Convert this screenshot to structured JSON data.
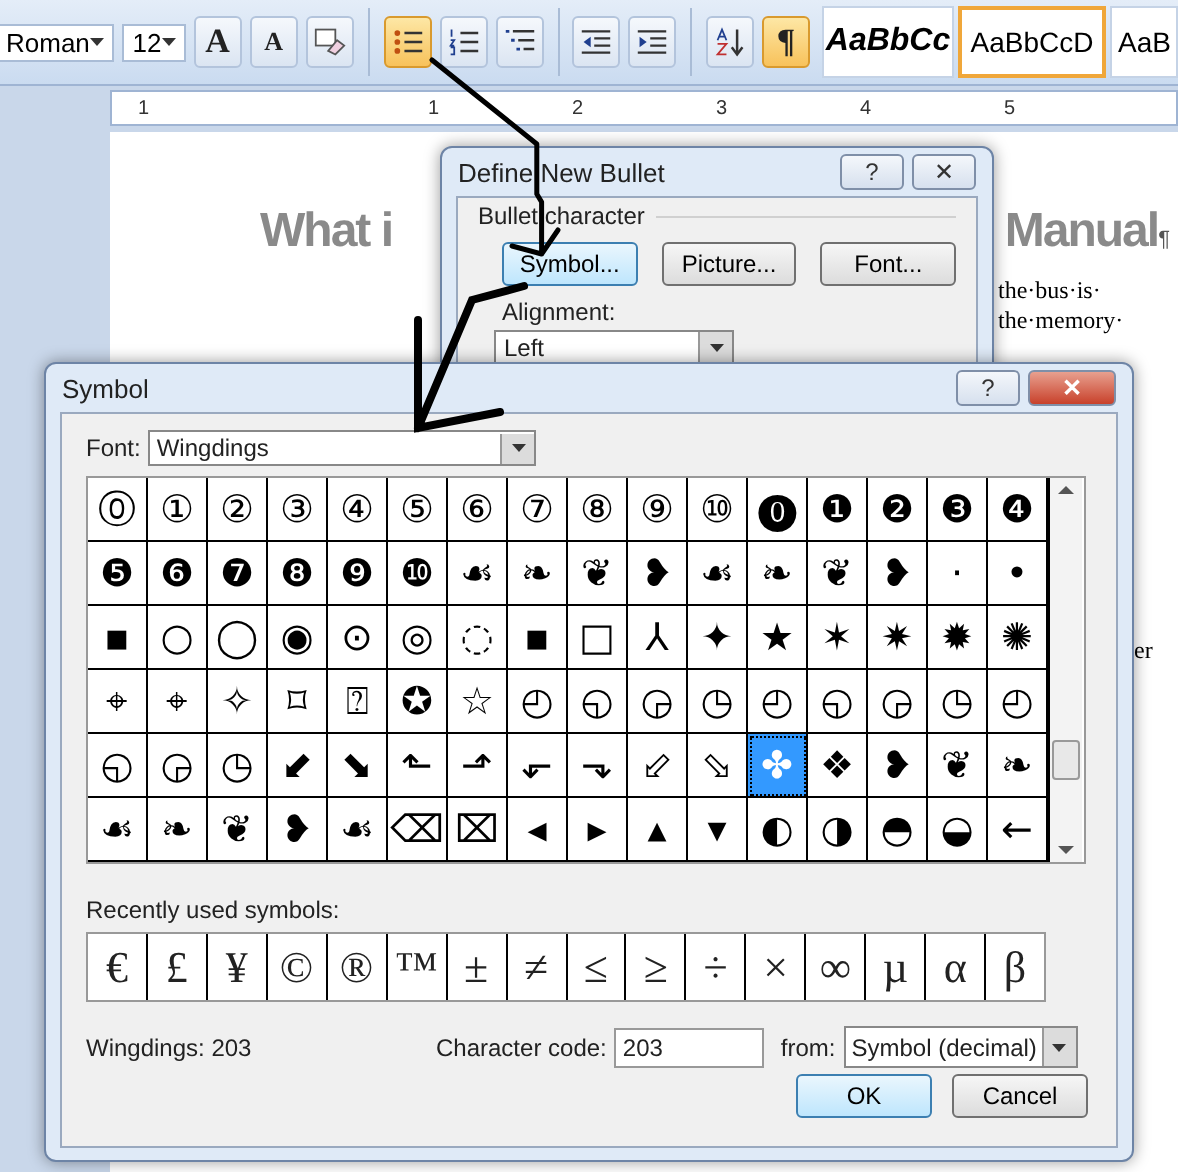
{
  "ribbon": {
    "font_name": "Roman",
    "font_size": "12",
    "buttons": [
      {
        "kind": "grow-font",
        "label": "A",
        "on": false
      },
      {
        "kind": "shrink-font",
        "label": "A",
        "on": false
      },
      {
        "kind": "clear-format",
        "on": false
      },
      {
        "kind": "bullets",
        "on": true
      },
      {
        "kind": "numbering",
        "on": false
      },
      {
        "kind": "multilevel",
        "on": false
      },
      {
        "kind": "outdent",
        "on": false
      },
      {
        "kind": "indent",
        "on": false
      },
      {
        "kind": "sort",
        "on": false
      },
      {
        "kind": "pilcrow",
        "label": "¶",
        "on": true
      }
    ],
    "styles": [
      {
        "label": "AaBbCc",
        "kind": "bold-italic",
        "selected": false
      },
      {
        "label": "AaBbCcD",
        "kind": "normal",
        "selected": true
      },
      {
        "label": "AaB",
        "kind": "normal",
        "selected": false
      }
    ]
  },
  "ruler": {
    "labels": [
      "1",
      "1",
      "2",
      "3",
      "4",
      "5"
    ]
  },
  "document": {
    "title_left": "What i",
    "title_right": "Manual",
    "pilcrow": "¶",
    "lines": [
      "the·bus·is·",
      "the·memory·"
    ],
    "side_text": "er"
  },
  "define_bullet_dialog": {
    "title": "Define New Bullet",
    "help": "?",
    "close": "✕",
    "group_label": "Bullet character",
    "buttons": [
      "Symbol...",
      "Picture...",
      "Font..."
    ],
    "alignment_label": "Alignment:",
    "alignment_value": "Left"
  },
  "symbol_dialog": {
    "title": "Symbol",
    "help": "?",
    "close": "✕",
    "font_label": "Font:",
    "font_value": "Wingdings",
    "cells": [
      {
        "symbol": "⓪",
        "selected": false
      },
      {
        "symbol": "①",
        "selected": false
      },
      {
        "symbol": "②",
        "selected": false
      },
      {
        "symbol": "③",
        "selected": false
      },
      {
        "symbol": "④",
        "selected": false
      },
      {
        "symbol": "⑤",
        "selected": false
      },
      {
        "symbol": "⑥",
        "selected": false
      },
      {
        "symbol": "⑦",
        "selected": false
      },
      {
        "symbol": "⑧",
        "selected": false
      },
      {
        "symbol": "⑨",
        "selected": false
      },
      {
        "symbol": "⑩",
        "selected": false
      },
      {
        "symbol": "⓿",
        "selected": false
      },
      {
        "symbol": "❶",
        "selected": false
      },
      {
        "symbol": "❷",
        "selected": false
      },
      {
        "symbol": "❸",
        "selected": false
      },
      {
        "symbol": "❹",
        "selected": false
      },
      {
        "symbol": "❺",
        "selected": false
      },
      {
        "symbol": "❻",
        "selected": false
      },
      {
        "symbol": "❼",
        "selected": false
      },
      {
        "symbol": "❽",
        "selected": false
      },
      {
        "symbol": "❾",
        "selected": false
      },
      {
        "symbol": "❿",
        "selected": false
      },
      {
        "symbol": "☙",
        "selected": false
      },
      {
        "symbol": "❧",
        "selected": false
      },
      {
        "symbol": "❦",
        "selected": false
      },
      {
        "symbol": "❥",
        "selected": false
      },
      {
        "symbol": "☙",
        "selected": false
      },
      {
        "symbol": "❧",
        "selected": false
      },
      {
        "symbol": "❦",
        "selected": false
      },
      {
        "symbol": "❥",
        "selected": false
      },
      {
        "symbol": "·",
        "selected": false
      },
      {
        "symbol": "•",
        "selected": false
      },
      {
        "symbol": "▪",
        "selected": false
      },
      {
        "symbol": "○",
        "selected": false
      },
      {
        "symbol": "◯",
        "selected": false
      },
      {
        "symbol": "◉",
        "selected": false
      },
      {
        "symbol": "⊙",
        "selected": false
      },
      {
        "symbol": "◎",
        "selected": false
      },
      {
        "symbol": "◌",
        "selected": false
      },
      {
        "symbol": "▪",
        "selected": false
      },
      {
        "symbol": "□",
        "selected": false
      },
      {
        "symbol": "⅄",
        "selected": false
      },
      {
        "symbol": "✦",
        "selected": false
      },
      {
        "symbol": "★",
        "selected": false
      },
      {
        "symbol": "✶",
        "selected": false
      },
      {
        "symbol": "✷",
        "selected": false
      },
      {
        "symbol": "✹",
        "selected": false
      },
      {
        "symbol": "✺",
        "selected": false
      },
      {
        "symbol": "⌖",
        "selected": false
      },
      {
        "symbol": "⌖",
        "selected": false
      },
      {
        "symbol": "✧",
        "selected": false
      },
      {
        "symbol": "⌑",
        "selected": false
      },
      {
        "symbol": "⍰",
        "selected": false
      },
      {
        "symbol": "✪",
        "selected": false
      },
      {
        "symbol": "☆",
        "selected": false
      },
      {
        "symbol": "◴",
        "selected": false
      },
      {
        "symbol": "◵",
        "selected": false
      },
      {
        "symbol": "◶",
        "selected": false
      },
      {
        "symbol": "◷",
        "selected": false
      },
      {
        "symbol": "◴",
        "selected": false
      },
      {
        "symbol": "◵",
        "selected": false
      },
      {
        "symbol": "◶",
        "selected": false
      },
      {
        "symbol": "◷",
        "selected": false
      },
      {
        "symbol": "◴",
        "selected": false
      },
      {
        "symbol": "◵",
        "selected": false
      },
      {
        "symbol": "◶",
        "selected": false
      },
      {
        "symbol": "◷",
        "selected": false
      },
      {
        "symbol": "⬋",
        "selected": false
      },
      {
        "symbol": "⬊",
        "selected": false
      },
      {
        "symbol": "⬑",
        "selected": false
      },
      {
        "symbol": "⬏",
        "selected": false
      },
      {
        "symbol": "⬐",
        "selected": false
      },
      {
        "symbol": "⬎",
        "selected": false
      },
      {
        "symbol": "⬃",
        "selected": false
      },
      {
        "symbol": "⬂",
        "selected": false
      },
      {
        "symbol": "✤",
        "selected": true
      },
      {
        "symbol": "❖",
        "selected": false
      },
      {
        "symbol": "❥",
        "selected": false
      },
      {
        "symbol": "❦",
        "selected": false
      },
      {
        "symbol": "❧",
        "selected": false
      },
      {
        "symbol": "☙",
        "selected": false
      },
      {
        "symbol": "❧",
        "selected": false
      },
      {
        "symbol": "❦",
        "selected": false
      },
      {
        "symbol": "❥",
        "selected": false
      },
      {
        "symbol": "☙",
        "selected": false
      },
      {
        "symbol": "⌫",
        "selected": false
      },
      {
        "symbol": "⌧",
        "selected": false
      },
      {
        "symbol": "◂",
        "selected": false
      },
      {
        "symbol": "▸",
        "selected": false
      },
      {
        "symbol": "▴",
        "selected": false
      },
      {
        "symbol": "▾",
        "selected": false
      },
      {
        "symbol": "◐",
        "selected": false
      },
      {
        "symbol": "◑",
        "selected": false
      },
      {
        "symbol": "◓",
        "selected": false
      },
      {
        "symbol": "◒",
        "selected": false
      },
      {
        "symbol": "←",
        "selected": false
      }
    ],
    "recent_label": "Recently used symbols:",
    "recent": [
      "€",
      "£",
      "¥",
      "©",
      "®",
      "™",
      "±",
      "≠",
      "≤",
      "≥",
      "÷",
      "×",
      "∞",
      "µ",
      "α",
      "β"
    ],
    "status": "Wingdings: 203",
    "code_label": "Character code:",
    "code_value": "203",
    "from_label": "from:",
    "from_value": "Symbol (decimal)",
    "buttons": [
      "OK",
      "Cancel"
    ]
  }
}
